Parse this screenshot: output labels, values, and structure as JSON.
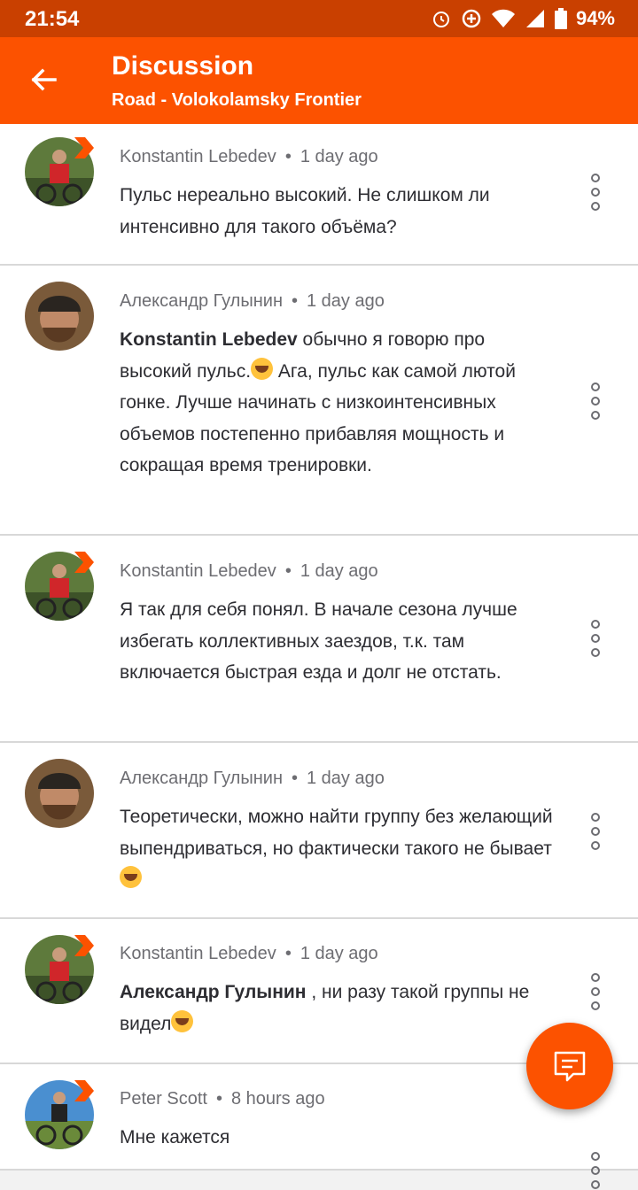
{
  "status_bar": {
    "time": "21:54",
    "battery": "94%"
  },
  "app_bar": {
    "title": "Discussion",
    "subtitle": "Road - Volokolamsky Frontier"
  },
  "comments": [
    {
      "author": "Konstantin Lebedev",
      "time": "1 day ago",
      "mention": "",
      "text": "Пульс нереально высокий. Не слишком ли интенсивно для такого объёма?"
    },
    {
      "author": "Александр Гулынин",
      "time": "1 day ago",
      "mention": "Konstantin Lebedev",
      "text": " обычно я говорю про высокий пульс.",
      "text_after_emoji": " Ага, пульс как самой лютой гонке. Лучше начинать с низкоинтенсивных объемов постепенно прибавляя мощность и сокращая время тренировки."
    },
    {
      "author": "Konstantin Lebedev",
      "time": "1 day ago",
      "mention": "",
      "text": "Я так для себя понял. В начале сезона лучше избегать коллективных заездов, т.к. там включается быстрая езда и долг не отстать."
    },
    {
      "author": "Александр Гулынин",
      "time": "1 day ago",
      "mention": "",
      "text": "Теоретически, можно найти группу без желающий выпендриваться, но фактически такого не бывает"
    },
    {
      "author": "Konstantin Lebedev",
      "time": "1 day ago",
      "mention": "Александр Гулынин",
      "text": " , ни разу такой группы не видел"
    },
    {
      "author": "Peter Scott",
      "time": "8 hours ago",
      "mention": "",
      "text": "Мне кажется"
    }
  ],
  "icons": {
    "back": "arrow-left-icon",
    "more": "more-vertical-icon",
    "fab": "comment-icon"
  },
  "colors": {
    "accent": "#fc5200",
    "status": "#c94000"
  }
}
